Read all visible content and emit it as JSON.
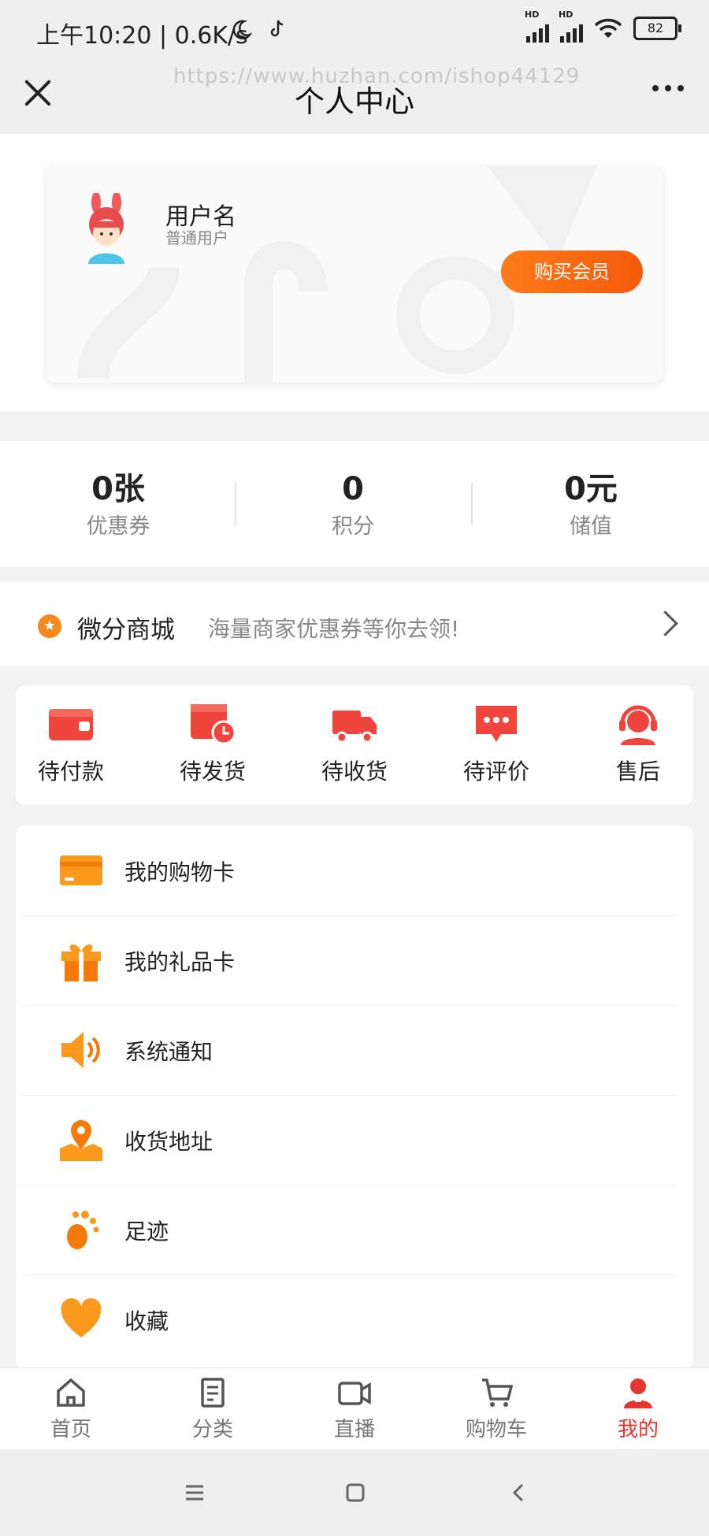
{
  "status": {
    "time": "上午10:20 | 0.6K/s",
    "signal1": "HD",
    "signal2": "HD",
    "battery": "82"
  },
  "header": {
    "watermark": "https://www.huzhan.com/ishop44129",
    "title": "个人中心"
  },
  "user": {
    "name": "用户名",
    "level": "普通用户",
    "buy_label": "购买会员"
  },
  "stats": [
    {
      "value": "0张",
      "label": "优惠券"
    },
    {
      "value": "0",
      "label": "积分"
    },
    {
      "value": "0元",
      "label": "储值"
    }
  ],
  "mall": {
    "title": "微分商城",
    "subtitle": "海量商家优惠券等你去领!"
  },
  "orders": [
    {
      "label": "待付款",
      "icon": "wallet-icon"
    },
    {
      "label": "待发货",
      "icon": "calendar-clock-icon"
    },
    {
      "label": "待收货",
      "icon": "truck-icon"
    },
    {
      "label": "待评价",
      "icon": "chat-bubble-icon"
    },
    {
      "label": "售后",
      "icon": "customer-service-icon"
    }
  ],
  "menu": [
    {
      "label": "我的购物卡",
      "icon": "card-icon"
    },
    {
      "label": "我的礼品卡",
      "icon": "gift-icon"
    },
    {
      "label": "系统通知",
      "icon": "speaker-icon"
    },
    {
      "label": "收货地址",
      "icon": "location-icon"
    },
    {
      "label": "足迹",
      "icon": "footprint-icon"
    },
    {
      "label": "收藏",
      "icon": "heart-icon"
    }
  ],
  "tabs": [
    {
      "label": "首页",
      "icon": "home-icon"
    },
    {
      "label": "分类",
      "icon": "category-icon"
    },
    {
      "label": "直播",
      "icon": "live-icon"
    },
    {
      "label": "购物车",
      "icon": "cart-icon"
    },
    {
      "label": "我的",
      "icon": "profile-icon",
      "active": true
    }
  ],
  "colors": {
    "accent_orange": "#f7891e",
    "order_red": "#f0453c",
    "active_tab": "#e8342e"
  }
}
